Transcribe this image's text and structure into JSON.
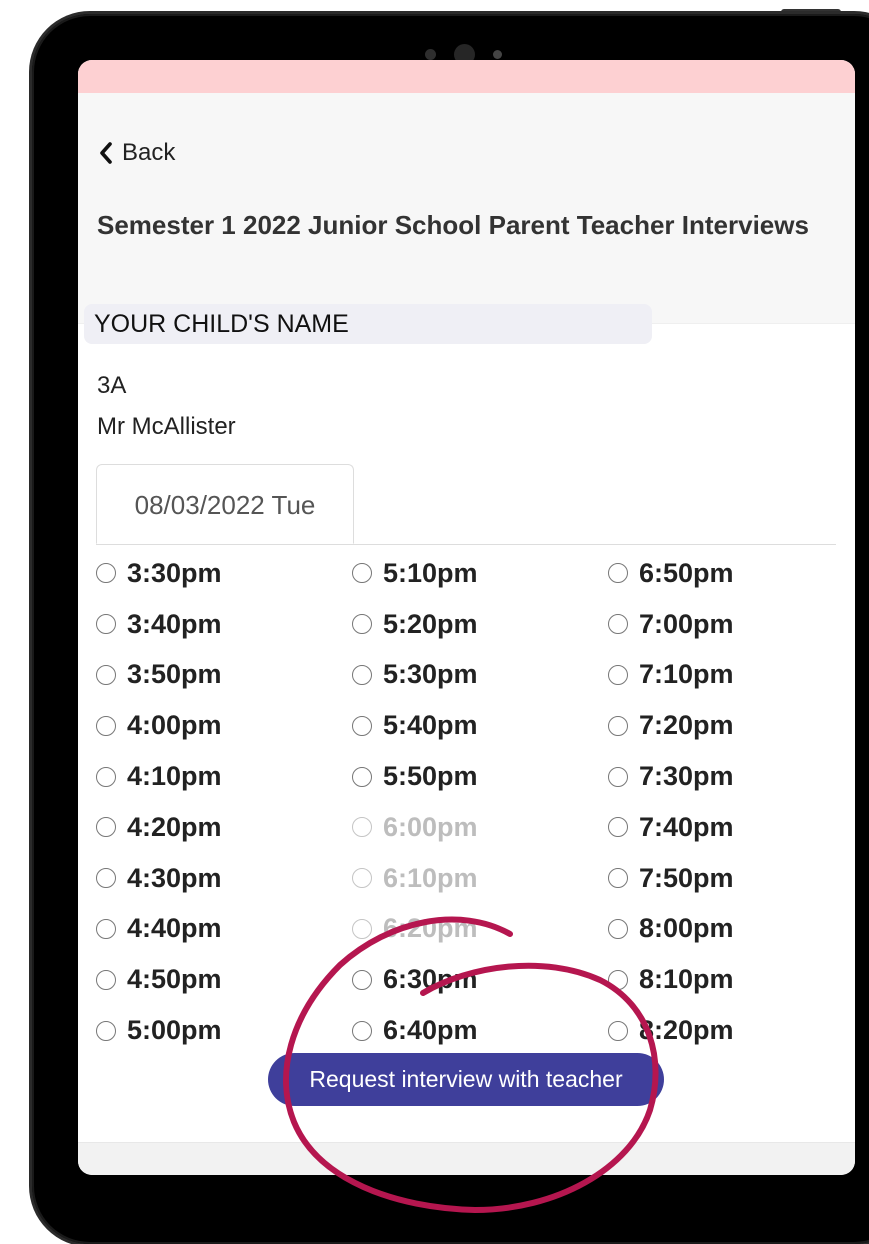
{
  "header": {
    "back_label": "Back",
    "title": "Semester 1 2022 Junior School Parent Teacher Interviews"
  },
  "child": {
    "name_placeholder": "YOUR CHILD'S NAME",
    "class": "3A",
    "teacher": "Mr McAllister"
  },
  "date_tab": "08/03/2022 Tue",
  "slots": [
    {
      "label": "3:30pm",
      "disabled": false
    },
    {
      "label": "3:40pm",
      "disabled": false
    },
    {
      "label": "3:50pm",
      "disabled": false
    },
    {
      "label": "4:00pm",
      "disabled": false
    },
    {
      "label": "4:10pm",
      "disabled": false
    },
    {
      "label": "4:20pm",
      "disabled": false
    },
    {
      "label": "4:30pm",
      "disabled": false
    },
    {
      "label": "4:40pm",
      "disabled": false
    },
    {
      "label": "4:50pm",
      "disabled": false
    },
    {
      "label": "5:00pm",
      "disabled": false
    },
    {
      "label": "5:10pm",
      "disabled": false
    },
    {
      "label": "5:20pm",
      "disabled": false
    },
    {
      "label": "5:30pm",
      "disabled": false
    },
    {
      "label": "5:40pm",
      "disabled": false
    },
    {
      "label": "5:50pm",
      "disabled": false
    },
    {
      "label": "6:00pm",
      "disabled": true
    },
    {
      "label": "6:10pm",
      "disabled": true
    },
    {
      "label": "6:20pm",
      "disabled": true
    },
    {
      "label": "6:30pm",
      "disabled": false
    },
    {
      "label": "6:40pm",
      "disabled": false
    },
    {
      "label": "6:50pm",
      "disabled": false
    },
    {
      "label": "7:00pm",
      "disabled": false
    },
    {
      "label": "7:10pm",
      "disabled": false
    },
    {
      "label": "7:20pm",
      "disabled": false
    },
    {
      "label": "7:30pm",
      "disabled": false
    },
    {
      "label": "7:40pm",
      "disabled": false
    },
    {
      "label": "7:50pm",
      "disabled": false
    },
    {
      "label": "8:00pm",
      "disabled": false
    },
    {
      "label": "8:10pm",
      "disabled": false
    },
    {
      "label": "8:20pm",
      "disabled": false
    }
  ],
  "request_button_label": "Request interview with teacher",
  "colors": {
    "status_bar": "#fdd0d2",
    "button": "#3f3f9b",
    "annotation": "#b5164f"
  },
  "icons": {
    "back": "chevron-left-icon",
    "highlight": "hand-drawn-circle-annotation"
  }
}
